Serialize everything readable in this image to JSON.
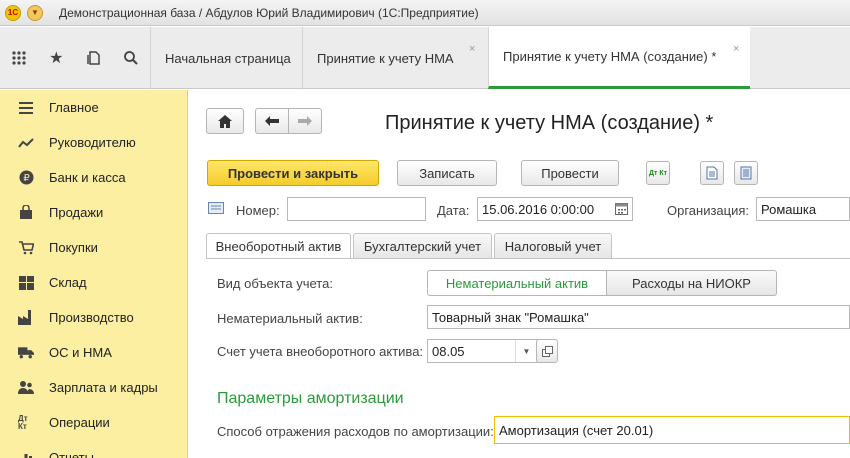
{
  "window": {
    "title": "Демонстрационная база / Абдулов Юрий Владимирович  (1С:Предприятие)"
  },
  "tabs": [
    {
      "label": "Начальная страница"
    },
    {
      "label": "Принятие к учету НМА",
      "close": "×"
    },
    {
      "label": "Принятие к учету НМА (создание) *",
      "close": "×"
    }
  ],
  "sidebar": {
    "items": [
      {
        "label": "Главное",
        "icon": "menu-lines-icon"
      },
      {
        "label": "Руководителю",
        "icon": "trend-icon"
      },
      {
        "label": "Банк и касса",
        "icon": "ruble-coin-icon"
      },
      {
        "label": "Продажи",
        "icon": "shopping-bag-icon"
      },
      {
        "label": "Покупки",
        "icon": "cart-icon"
      },
      {
        "label": "Склад",
        "icon": "warehouse-icon"
      },
      {
        "label": "Производство",
        "icon": "factory-icon"
      },
      {
        "label": "ОС и НМА",
        "icon": "truck-icon"
      },
      {
        "label": "Зарплата и кадры",
        "icon": "people-icon"
      },
      {
        "label": "Операции",
        "icon": "dt-kt-icon",
        "glyph": "Дт Кт"
      },
      {
        "label": "Отчеты",
        "icon": "report-icon"
      }
    ]
  },
  "form": {
    "title": "Принятие к учету НМА (создание) *",
    "buttons": {
      "post_close": "Провести и закрыть",
      "save": "Записать",
      "post": "Провести"
    },
    "dtkt_glyph": "Дт Кт",
    "number_label": "Номер:",
    "number_value": "",
    "date_label": "Дата:",
    "date_value": "15.06.2016  0:00:00",
    "org_label": "Организация:",
    "org_value": "Ромашка",
    "inner_tabs": [
      "Внеоборотный актив",
      "Бухгалтерский учет",
      "Налоговый учет"
    ],
    "object_type_label": "Вид объекта учета:",
    "object_type_options": [
      "Нематериальный актив",
      "Расходы на НИОКР"
    ],
    "asset_label": "Нематериальный актив:",
    "asset_value": "Товарный знак \"Ромашка\"",
    "account_label": "Счет учета внеоборотного актива:",
    "account_value": "08.05",
    "section_title": "Параметры амортизации",
    "amort_label": "Способ отражения расходов по амортизации:",
    "amort_value": "Амортизация (счет 20.01)"
  },
  "colors": {
    "accent_green": "#2a9a3a",
    "primary_yellow": "#f4cc2a",
    "sidebar_bg": "#fcefa1"
  }
}
